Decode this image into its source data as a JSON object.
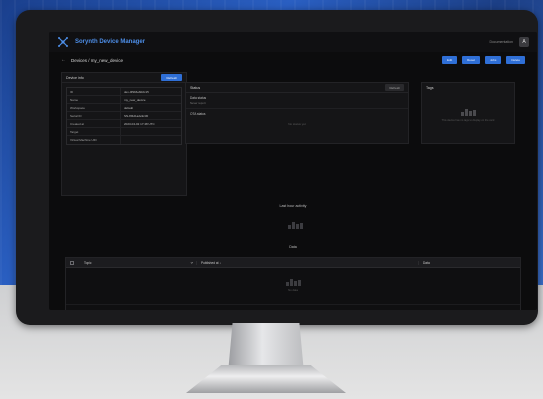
{
  "header": {
    "app_title": "Sorynth Device Manager",
    "user_label": "Documentation",
    "user_initial": "A"
  },
  "page": {
    "title": "Devices / my_new_device"
  },
  "actions": [
    "Edit",
    "Reset",
    "Jobs",
    "Delete"
  ],
  "device_card": {
    "title": "Device info",
    "button_label": "Refresh",
    "rows": [
      {
        "key": "ID",
        "value": "dev-0f9b6e8d2c15"
      },
      {
        "key": "Name",
        "value": "my_new_device"
      },
      {
        "key": "Workspace",
        "value": "default"
      },
      {
        "key": "Serial ID",
        "value": "SN-8f4d1a2e9c30"
      },
      {
        "key": "Created at",
        "value": "2023-04-02 17:48 UTC"
      },
      {
        "key": "Target",
        "value": ""
      },
      {
        "key": "Virtual Machine UID",
        "value": ""
      }
    ]
  },
  "status_card": {
    "title": "Status",
    "button_label": "Refresh",
    "blocks": [
      {
        "label": "Data status",
        "sub": "Never report"
      },
      {
        "label": "OTA status",
        "sub": ""
      }
    ],
    "empty_text": "No status yet"
  },
  "tags_card": {
    "title": "Tags",
    "empty_text": "This device has no tags to display on the card"
  },
  "activity": {
    "heading": "Last hour activity"
  },
  "data_section": {
    "heading": "Data",
    "columns": {
      "topic": "Topic",
      "published": "Published at ↓",
      "data": "Data"
    },
    "empty_text": "No data"
  }
}
